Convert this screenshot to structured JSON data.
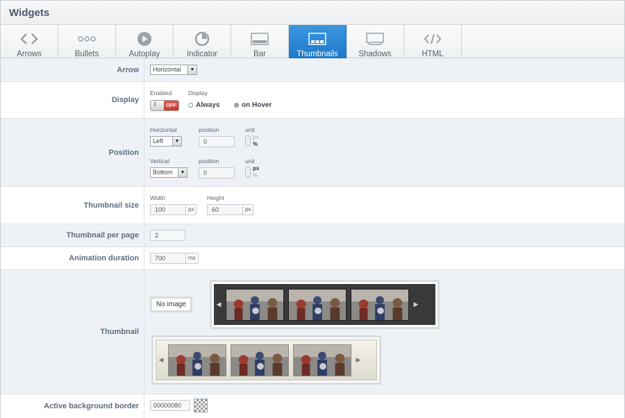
{
  "panel": {
    "title": "Widgets"
  },
  "tabs": [
    {
      "label": "Arrows",
      "icon": "angle-brackets-icon"
    },
    {
      "label": "Bullets",
      "icon": "dots-icon"
    },
    {
      "label": "Autoplay",
      "icon": "play-icon"
    },
    {
      "label": "Indicator",
      "icon": "pie-indicator-icon"
    },
    {
      "label": "Bar",
      "icon": "bar-icon"
    },
    {
      "label": "Thumbnails",
      "icon": "thumbnails-icon",
      "active": true
    },
    {
      "label": "Shadows",
      "icon": "shadow-icon"
    },
    {
      "label": "HTML",
      "icon": "code-icon"
    }
  ],
  "arrow": {
    "label": "Arrow",
    "value": "Horizontal"
  },
  "display": {
    "label": "Display",
    "enabled_label": "Enabled",
    "toggle_off": "OFF",
    "display_label": "Display",
    "options": [
      "Always",
      "on Hover"
    ],
    "selected": "on Hover"
  },
  "position": {
    "label": "Position",
    "horizontal_label": "Horizontal",
    "horizontal_value": "Left",
    "h_position_label": "position",
    "h_position_value": "0",
    "h_unit_label": "unit",
    "vertical_label": "Vertical",
    "vertical_value": "Bottom",
    "v_position_label": "position",
    "v_position_value": "0",
    "v_unit_label": "unit",
    "unit_px": "px",
    "unit_pct": "%"
  },
  "thumbnail_size": {
    "label": "Thumbnail size",
    "width_label": "Width",
    "width_value": "100",
    "width_unit": "px",
    "height_label": "Height",
    "height_value": "60",
    "height_unit": "px"
  },
  "per_page": {
    "label": "Thumbnail per page",
    "value": "2"
  },
  "animation": {
    "label": "Animation duration",
    "value": "700",
    "unit": "ms"
  },
  "thumbnail": {
    "label": "Thumbnail",
    "no_image": "No image",
    "left_arrow": "◀",
    "right_arrow": "▶"
  },
  "active_border": {
    "label": "Active background border",
    "value": "00000080"
  },
  "colors": {
    "accent": "#2185d0",
    "toggle_off": "#d0453a"
  }
}
